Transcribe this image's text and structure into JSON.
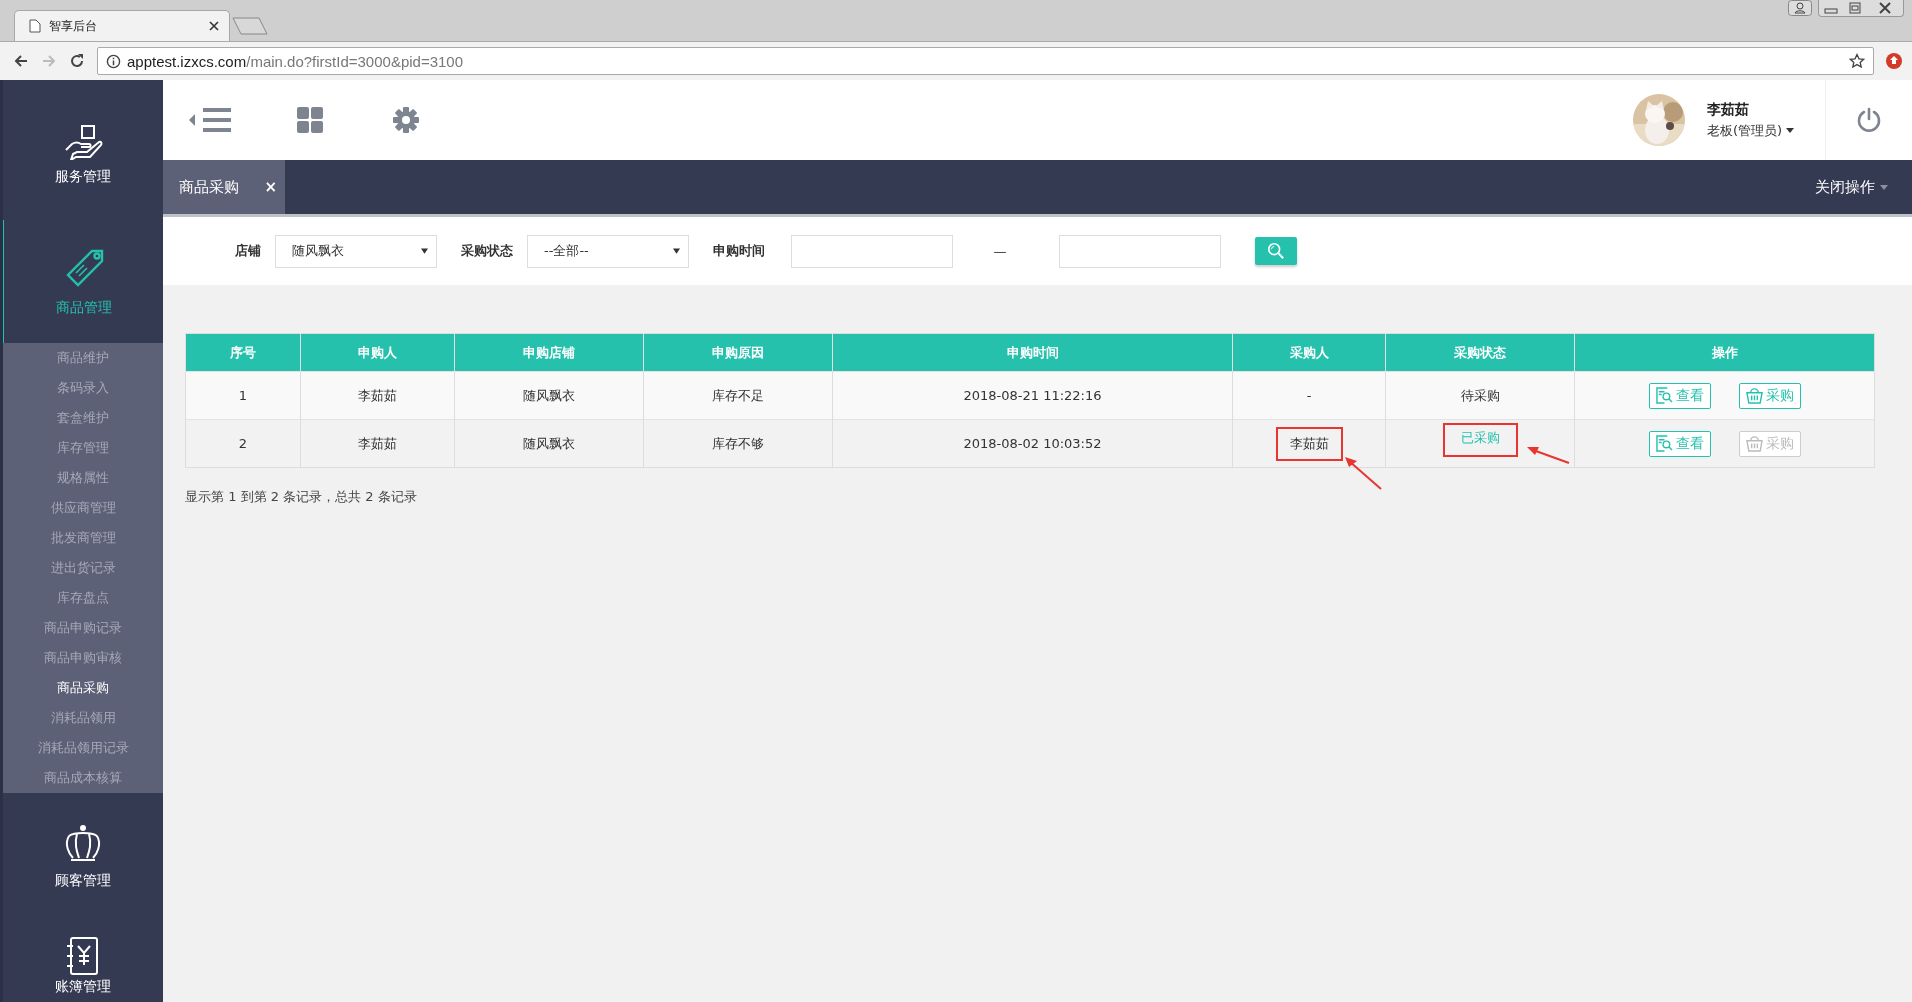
{
  "browser": {
    "tab_title": "智享后台",
    "url_host": "apptest.izxcs.com",
    "url_path": "/main.do?firstId=3000&pid=3100"
  },
  "sidebar": {
    "sections": [
      {
        "label": "服务管理",
        "kind": "service",
        "selected": false
      },
      {
        "label": "商品管理",
        "kind": "sale",
        "selected": true,
        "children": [
          {
            "label": "商品维护",
            "selected": false
          },
          {
            "label": "条码录入",
            "selected": false
          },
          {
            "label": "套盒维护",
            "selected": false
          },
          {
            "label": "库存管理",
            "selected": false
          },
          {
            "label": "规格属性",
            "selected": false
          },
          {
            "label": "供应商管理",
            "selected": false
          },
          {
            "label": "批发商管理",
            "selected": false
          },
          {
            "label": "进出货记录",
            "selected": false
          },
          {
            "label": "库存盘点",
            "selected": false
          },
          {
            "label": "商品申购记录",
            "selected": false
          },
          {
            "label": "商品申购审核",
            "selected": false
          },
          {
            "label": "商品采购",
            "selected": true
          },
          {
            "label": "消耗品领用",
            "selected": false
          },
          {
            "label": "消耗品领用记录",
            "selected": false
          },
          {
            "label": "商品成本核算",
            "selected": false
          }
        ]
      },
      {
        "label": "顾客管理",
        "kind": "crown",
        "selected": false
      },
      {
        "label": "账簿管理",
        "kind": "ledger",
        "selected": false
      }
    ]
  },
  "header": {
    "user_name": "李茹茹",
    "user_role": "老板(管理员)"
  },
  "tabs": [
    {
      "label": "商品采购",
      "selected": true,
      "close": "×"
    }
  ],
  "close_ops": "关闭操作",
  "filters": {
    "store_label": "店铺",
    "store_value": "随风飘衣",
    "status_label": "采购状态",
    "status_value": "--全部--",
    "time_label": "申购时间",
    "time_sep": "—"
  },
  "table": {
    "columns": [
      "序号",
      "申购人",
      "申购店铺",
      "申购原因",
      "申购时间",
      "采购人",
      "采购状态",
      "操作"
    ],
    "rows": [
      {
        "cells": [
          "1",
          "李茹茹",
          "随风飘衣",
          "库存不足",
          "2018-08-21 11:22:16",
          "-",
          "待采购"
        ],
        "purchased": false,
        "annotated": false,
        "view": "查看",
        "buy": "采购"
      },
      {
        "cells": [
          "2",
          "李茹茹",
          "随风飘衣",
          "库存不够",
          "2018-08-02 10:03:52",
          "李茹茹",
          "已采购"
        ],
        "purchased": true,
        "annotated": true,
        "view": "查看",
        "buy": "采购"
      }
    ]
  },
  "summary": "显示第 1 到第 2 条记录，总共 2 条记录"
}
